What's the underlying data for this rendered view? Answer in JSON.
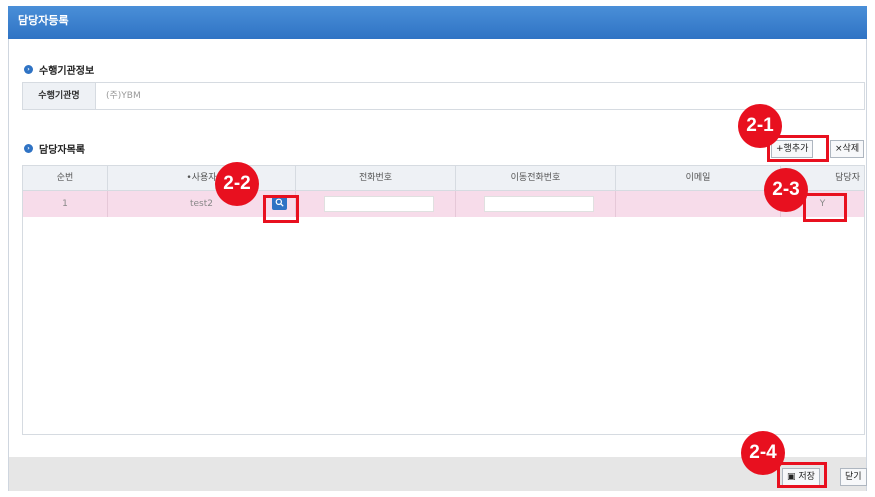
{
  "window": {
    "title": "담당자등록"
  },
  "section1": {
    "title": "수행기관정보",
    "agency_label": "수행기관명",
    "agency_value": "(주)YBM"
  },
  "section2": {
    "title": "담당자목록",
    "add_row_label": "+행추가",
    "delete_label": "×삭제"
  },
  "table": {
    "columns": [
      "순번",
      "•사용자",
      "전화번호",
      "이동전화번호",
      "이메일",
      "담당자"
    ],
    "rows": [
      {
        "seq": "1",
        "user": "test2",
        "phone": "",
        "mobile": "",
        "email": "",
        "primary": "Y"
      }
    ]
  },
  "footer": {
    "save_label": "저장",
    "close_label": "닫기"
  },
  "callouts": {
    "c21": "2-1",
    "c22": "2-2",
    "c23": "2-3",
    "c24": "2-4"
  },
  "colors": {
    "accent": "#2f73c4",
    "highlight_row": "#f7dcea",
    "callout": "#e8101f"
  }
}
